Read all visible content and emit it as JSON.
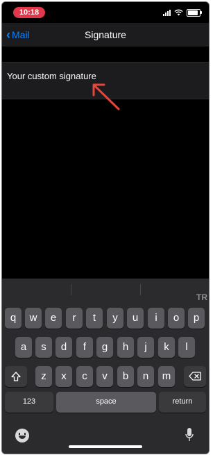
{
  "status_bar": {
    "time": "10:18"
  },
  "nav": {
    "back_label": "Mail",
    "title": "Signature"
  },
  "signature": {
    "text": "Your custom signature"
  },
  "keyboard": {
    "row1": [
      "q",
      "w",
      "e",
      "r",
      "t",
      "y",
      "u",
      "i",
      "o",
      "p"
    ],
    "row2": [
      "a",
      "s",
      "d",
      "f",
      "g",
      "h",
      "j",
      "k",
      "l"
    ],
    "row3": [
      "z",
      "x",
      "c",
      "v",
      "b",
      "n",
      "m"
    ],
    "numbers_label": "123",
    "space_label": "space",
    "return_label": "return",
    "watermark": "TR"
  },
  "colors": {
    "accent": "#0a84ff",
    "time_pill": "#e0384a",
    "annotation_arrow": "#e8453c"
  }
}
